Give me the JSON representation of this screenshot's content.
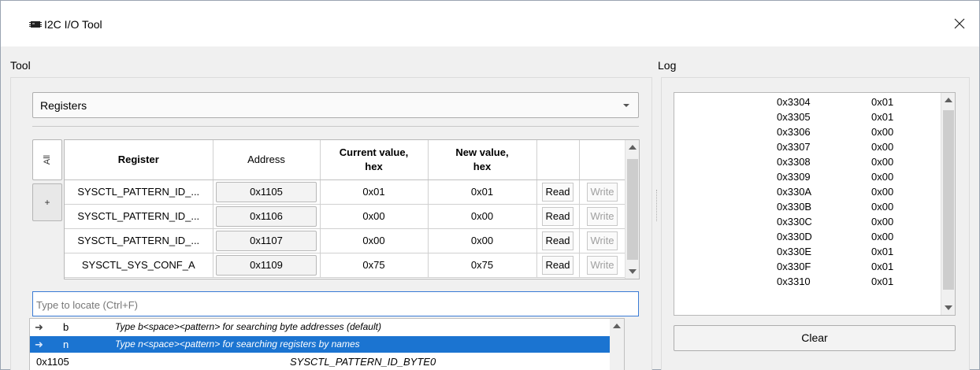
{
  "window": {
    "title": "I2C I/O Tool",
    "close_icon": "close-icon",
    "app_icon": "chip-icon"
  },
  "tool": {
    "group_label": "Tool",
    "mode_combo": {
      "selected": "Registers",
      "icon": "chevron-down-icon"
    },
    "side_tabs": {
      "all_label": "All",
      "add_label": "+"
    },
    "table": {
      "headers": {
        "register": "Register",
        "address": "Address",
        "current_line1": "Current value,",
        "current_line2": "hex",
        "new_line1": "New value,",
        "new_line2": "hex"
      },
      "rows": [
        {
          "register": "SYSCTL_PATTERN_ID_...",
          "address": "0x1105",
          "current": "0x01",
          "new": "0x01",
          "read": "Read",
          "write": "Write"
        },
        {
          "register": "SYSCTL_PATTERN_ID_...",
          "address": "0x1106",
          "current": "0x00",
          "new": "0x00",
          "read": "Read",
          "write": "Write"
        },
        {
          "register": "SYSCTL_PATTERN_ID_...",
          "address": "0x1107",
          "current": "0x00",
          "new": "0x00",
          "read": "Read",
          "write": "Write"
        },
        {
          "register": "SYSCTL_SYS_CONF_A",
          "address": "0x1109",
          "current": "0x75",
          "new": "0x75",
          "read": "Read",
          "write": "Write"
        }
      ]
    },
    "search": {
      "placeholder": "Type to locate (Ctrl+F)",
      "value": ""
    },
    "completions": [
      {
        "icon": "arrow-right-icon",
        "key": "b",
        "description": "Type b<space><pattern> for searching byte addresses (default)"
      },
      {
        "icon": "arrow-right-icon",
        "key": "n",
        "description": "Type n<space><pattern> for searching registers by names",
        "selected": true
      }
    ],
    "completion_match": {
      "address": "0x1105",
      "name": "SYSCTL_PATTERN_ID_BYTE0"
    }
  },
  "log": {
    "group_label": "Log",
    "entries": [
      {
        "address": "0x3304",
        "value": "0x01"
      },
      {
        "address": "0x3305",
        "value": "0x01"
      },
      {
        "address": "0x3306",
        "value": "0x00"
      },
      {
        "address": "0x3307",
        "value": "0x00"
      },
      {
        "address": "0x3308",
        "value": "0x00"
      },
      {
        "address": "0x3309",
        "value": "0x00"
      },
      {
        "address": "0x330A",
        "value": "0x00"
      },
      {
        "address": "0x330B",
        "value": "0x00"
      },
      {
        "address": "0x330C",
        "value": "0x00"
      },
      {
        "address": "0x330D",
        "value": "0x00"
      },
      {
        "address": "0x330E",
        "value": "0x01"
      },
      {
        "address": "0x330F",
        "value": "0x01"
      },
      {
        "address": "0x3310",
        "value": "0x01"
      }
    ],
    "clear_label": "Clear"
  },
  "colors": {
    "selection": "#1b74d1",
    "focus_border": "#3a7bd5",
    "window_bg": "#f0f0f0"
  }
}
